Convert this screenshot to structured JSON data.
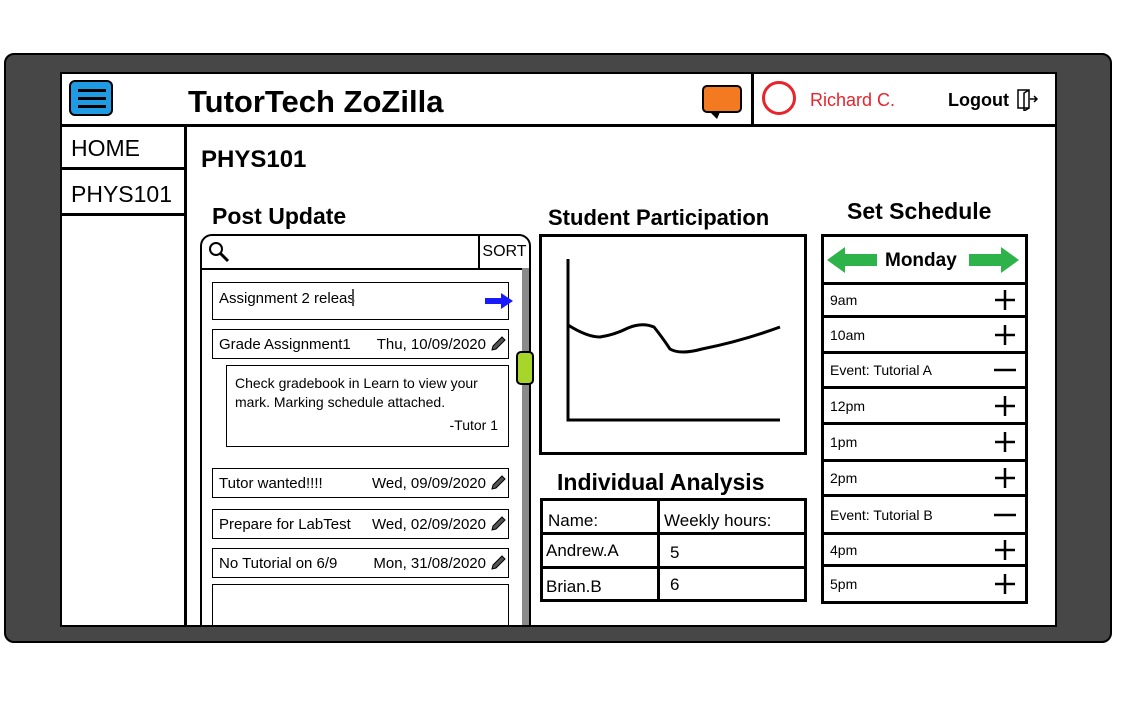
{
  "app": {
    "title": "TutorTech ZoZilla"
  },
  "user": {
    "name": "Richard C.",
    "logout_label": "Logout"
  },
  "sidebar": {
    "items": [
      {
        "label": "HOME"
      },
      {
        "label": "PHYS101"
      }
    ]
  },
  "course": {
    "title": "PHYS101"
  },
  "post_update": {
    "title": "Post Update",
    "sort_label": "SORT",
    "compose_text": "Assignment 2 releas",
    "posts": [
      {
        "title": "Grade Assignment1",
        "date": "Thu, 10/09/2020",
        "body": "Check gradebook in Learn to view your mark. Marking schedule attached.",
        "signature": "-Tutor 1"
      },
      {
        "title": "Tutor wanted!!!!",
        "date": "Wed, 09/09/2020"
      },
      {
        "title": "Prepare for LabTest",
        "date": "Wed, 02/09/2020"
      },
      {
        "title": "No Tutorial on 6/9",
        "date": "Mon, 31/08/2020"
      }
    ]
  },
  "participation": {
    "title": "Student Participation"
  },
  "individual_analysis": {
    "title": "Individual Analysis",
    "headers": [
      "Name:",
      "Weekly hours:"
    ],
    "rows": [
      [
        "Andrew.A",
        "5"
      ],
      [
        "Brian.B",
        "6"
      ]
    ]
  },
  "schedule": {
    "title": "Set Schedule",
    "day": "Monday",
    "slots": [
      {
        "label": "9am",
        "action": "add"
      },
      {
        "label": "10am",
        "action": "add"
      },
      {
        "label": "Event: Tutorial A",
        "action": "remove"
      },
      {
        "label": "12pm",
        "action": "add"
      },
      {
        "label": "1pm",
        "action": "add"
      },
      {
        "label": "2pm",
        "action": "add"
      },
      {
        "label": "Event: Tutorial B",
        "action": "remove"
      },
      {
        "label": "4pm",
        "action": "add"
      },
      {
        "label": "5pm",
        "action": "add"
      }
    ]
  },
  "colors": {
    "menu": "#1f9be4",
    "chat": "#f47a21",
    "user": "#e8232b",
    "arrows": "#2eb34a",
    "scroll_thumb": "#a8d52a",
    "send_arrow": "#1a1aff"
  },
  "icons": [
    "menu-icon",
    "chat-icon",
    "avatar-icon",
    "logout-icon",
    "search-icon",
    "send-arrow-icon",
    "pencil-icon",
    "left-arrow-icon",
    "right-arrow-icon",
    "plus-icon",
    "minus-icon"
  ]
}
